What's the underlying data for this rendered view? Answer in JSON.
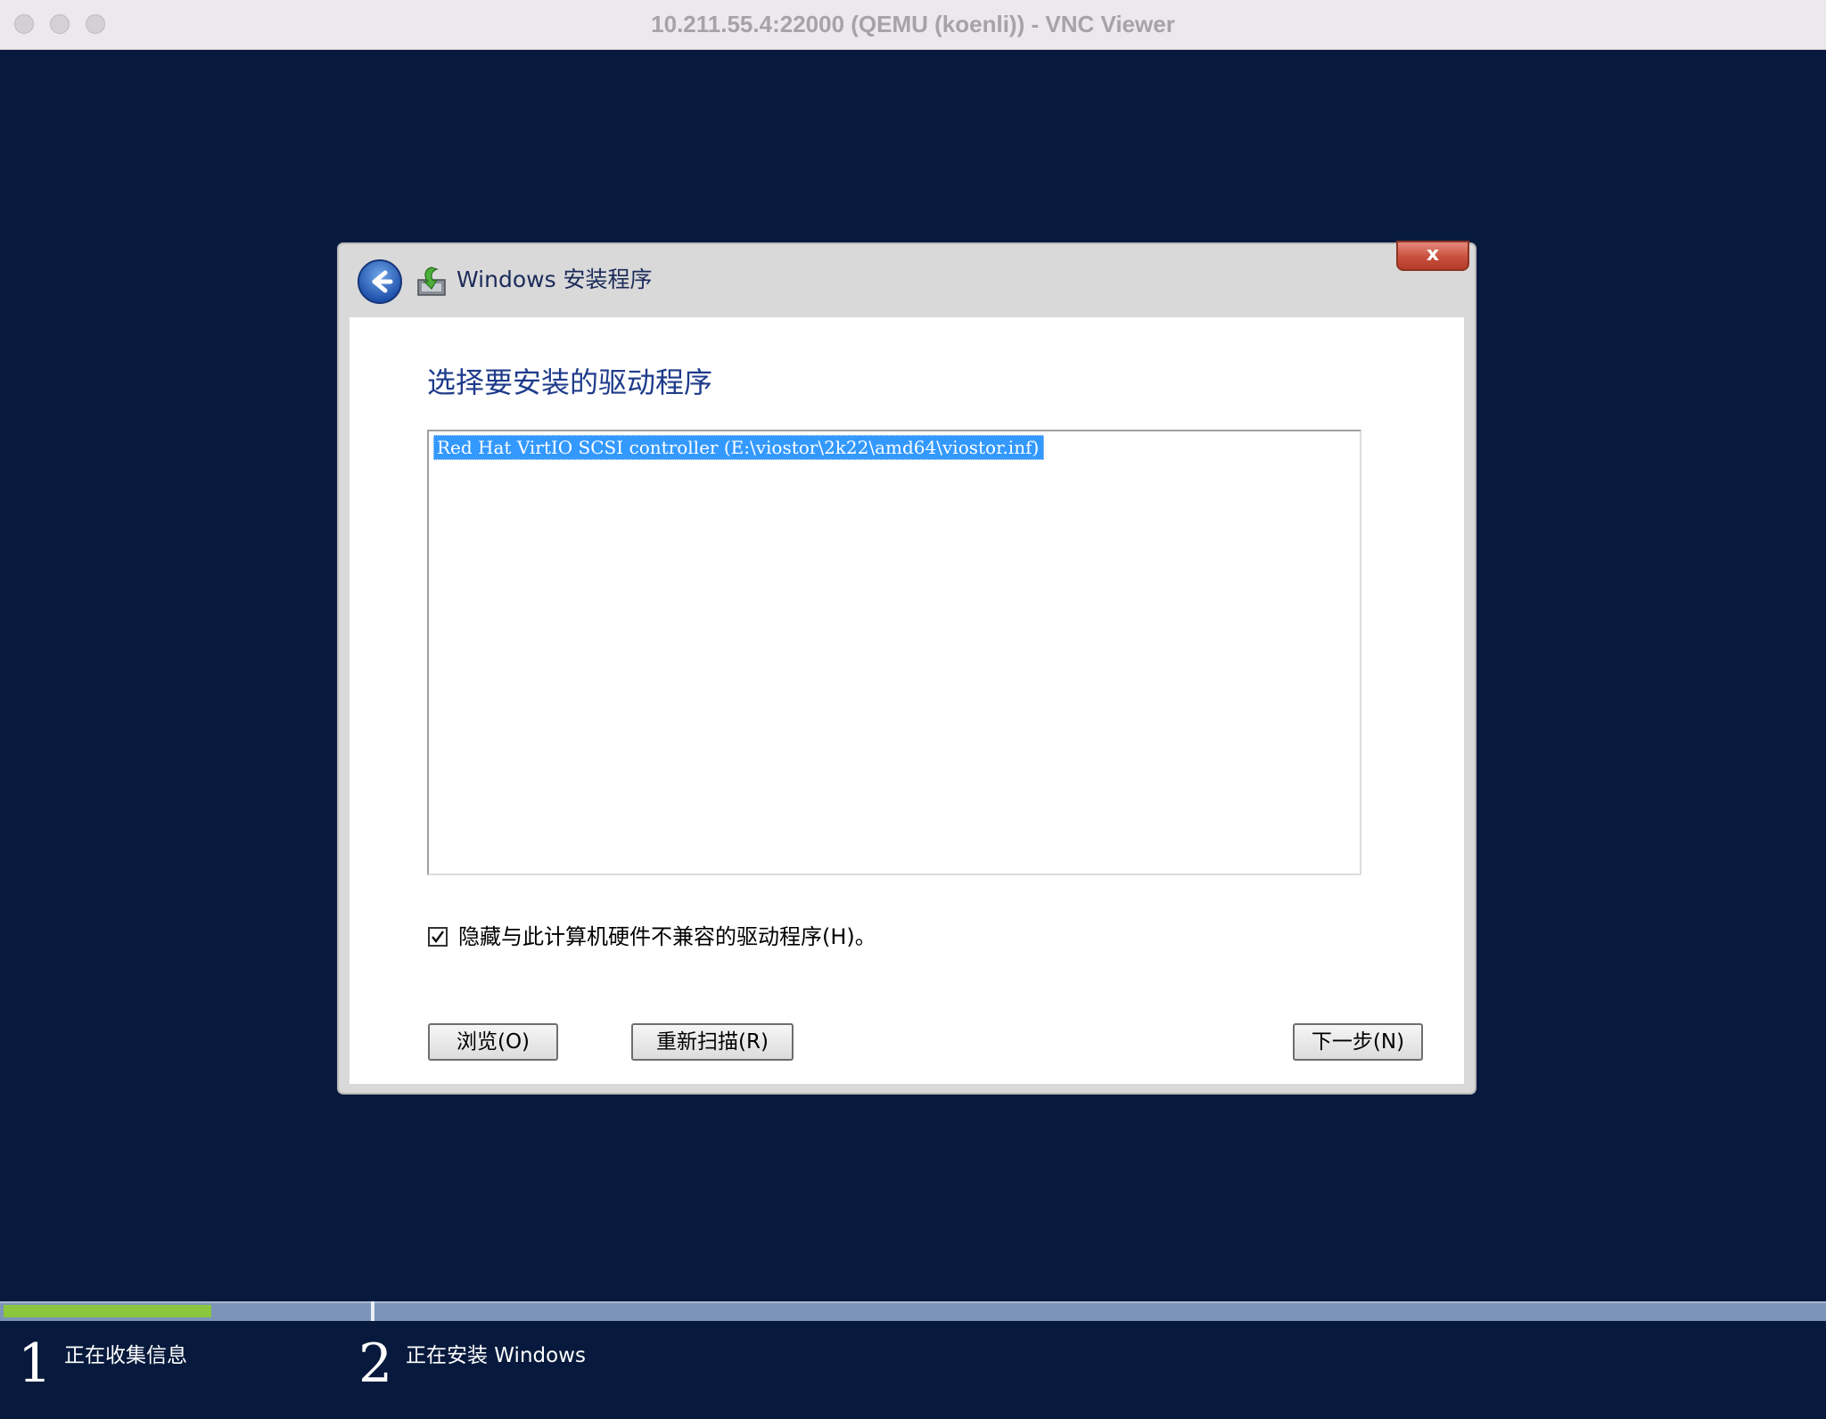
{
  "window": {
    "title": "10.211.55.4:22000 (QEMU (koenli)) - VNC Viewer"
  },
  "dialog": {
    "title": "Windows 安装程序",
    "close_glyph": "x",
    "icons": {
      "back": "back-arrow-icon",
      "setup": "setup-installer-icon"
    },
    "heading": "选择要安装的驱动程序",
    "drivers": [
      {
        "label": "Red Hat VirtIO SCSI controller (E:\\viostor\\2k22\\amd64\\viostor.inf)",
        "selected": true
      }
    ],
    "hide_incompatible": {
      "checked": true,
      "label": "隐藏与此计算机硬件不兼容的驱动程序(H)。"
    },
    "buttons": {
      "browse": "浏览(O)",
      "rescan": "重新扫描(R)",
      "next": "下一步(N)"
    }
  },
  "setup_steps": [
    {
      "number": "1",
      "label": "正在收集信息",
      "progress": 0.57
    },
    {
      "number": "2",
      "label": "正在安装 Windows",
      "progress": 0
    }
  ],
  "colors": {
    "desktop_bg": "#071a3d",
    "heading": "#1e3b8b",
    "selection": "#3399ff",
    "progress_fill": "#8cc63f",
    "progress_track": "#7b94b8"
  }
}
